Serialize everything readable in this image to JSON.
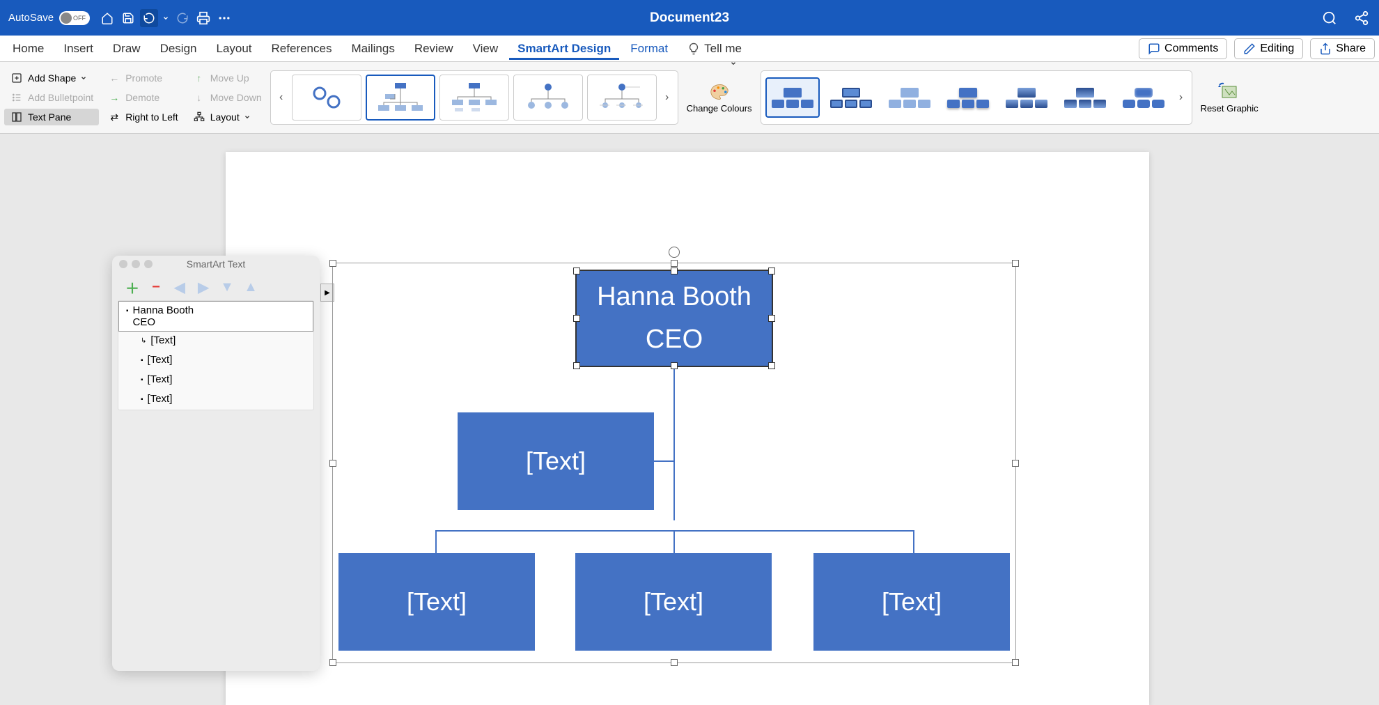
{
  "titlebar": {
    "autosave_label": "AutoSave",
    "autosave_state": "OFF",
    "document_title": "Document23"
  },
  "tabs": {
    "home": "Home",
    "insert": "Insert",
    "draw": "Draw",
    "design": "Design",
    "layout": "Layout",
    "references": "References",
    "mailings": "Mailings",
    "review": "Review",
    "view": "View",
    "smartart": "SmartArt Design",
    "format": "Format",
    "tellme": "Tell me",
    "comments": "Comments",
    "editing": "Editing",
    "share": "Share"
  },
  "ribbon": {
    "add_shape": "Add Shape",
    "add_bulletpoint": "Add Bulletpoint",
    "text_pane": "Text Pane",
    "promote": "Promote",
    "demote": "Demote",
    "right_to_left": "Right to Left",
    "move_up": "Move Up",
    "move_down": "Move Down",
    "layout": "Layout",
    "change_colours": "Change Colours",
    "reset_graphic": "Reset Graphic"
  },
  "text_panel": {
    "title": "SmartArt Text",
    "items": [
      {
        "text": "Hanna Booth",
        "sub": "CEO",
        "level": 0,
        "selected": true
      },
      {
        "text": "[Text]",
        "level": 1,
        "assistant": true
      },
      {
        "text": "[Text]",
        "level": 1
      },
      {
        "text": "[Text]",
        "level": 1
      },
      {
        "text": "[Text]",
        "level": 1
      }
    ]
  },
  "smartart": {
    "top": {
      "line1": "Hanna Booth",
      "line2": "CEO"
    },
    "assistant": "[Text]",
    "children": [
      "[Text]",
      "[Text]",
      "[Text]"
    ]
  }
}
